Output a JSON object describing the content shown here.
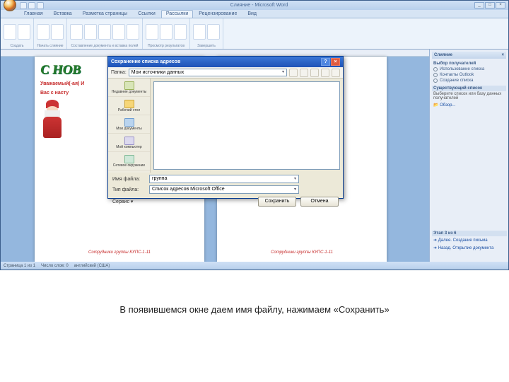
{
  "title": "Слияние - Microsoft Word",
  "win_buttons": {
    "min": "_",
    "max": "□",
    "close": "×"
  },
  "tabs": [
    "Главная",
    "Вставка",
    "Разметка страницы",
    "Ссылки",
    "Рассылки",
    "Рецензирование",
    "Вид"
  ],
  "active_tab": 4,
  "ribbon_groups": [
    "Создать",
    "Начать слияние",
    "Составление документа и вставка полей",
    "Просмотр результатов",
    "Завершить"
  ],
  "doc": {
    "greeting": "С НОВ",
    "congrats_line1": "Уважаемый(-ая) И",
    "congrats_line2": "Вас с насту",
    "footer": "Сотрудники группы КУПС-1-11"
  },
  "taskpane": {
    "title": "Слияние",
    "section1": "Выбор получателей",
    "opts": [
      "Использование списка",
      "Контакты Outlook",
      "Создание списка"
    ],
    "section2": "Существующий список",
    "hint": "Выберите список или базу данных получателей",
    "browse": "Обзор...",
    "footer_head": "Этап 3 из 6",
    "next": "Далее. Создание письма",
    "prev": "Назад. Открытие документа"
  },
  "dialog": {
    "title": "Сохранение списка адресов",
    "lookin_label": "Папка:",
    "lookin_value": "Мои источники данных",
    "places": [
      "Недавние документы",
      "Рабочий стол",
      "Мои документы",
      "Мой компьютер",
      "Сетевое окружение"
    ],
    "filename_label": "Имя файла:",
    "filename_value": "группа",
    "filetype_label": "Тип файла:",
    "filetype_value": "Список адресов Microsoft Office",
    "tools": "Сервис ▾",
    "save": "Сохранить",
    "cancel": "Отмена"
  },
  "status": {
    "page": "Страница 1 из 1",
    "words": "Число слов: 0",
    "lang": "английский (США)"
  },
  "caption": "В появившемся окне даем имя файлу, нажимаем «Сохранить»"
}
